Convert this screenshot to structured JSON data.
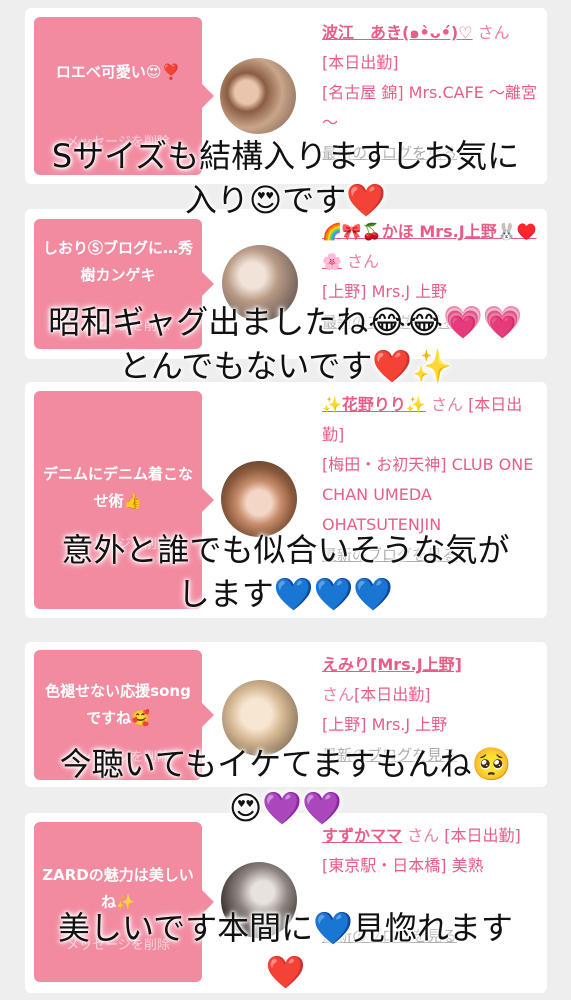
{
  "delete_label": "メッセージを削除",
  "blog_label": "最新のブログを見る",
  "san_suffix": "さん",
  "cards": [
    {
      "message": "ロエベ可愛い😍❣️",
      "name": "波江　あき(๑•̀ᴗ•́)♡",
      "status": "[本日出勤]",
      "shop": "[名古屋 錦] Mrs.CAFE ～離宮～"
    },
    {
      "message": "しおりⓈブログに…秀樹カンゲキ",
      "name": "🌈🎀🍒かほ Mrs.J上野🐰♥️🌸",
      "status": "",
      "shop": "[上野] Mrs.J 上野"
    },
    {
      "message": "デニムにデニム着こなせ術👍",
      "name": "✨花野りり✨",
      "status": "[本日出勤]",
      "shop": "[梅田・お初天神] CLUB ONE CHAN UMEDA OHATSUTENJIN"
    },
    {
      "message": "色褪せない応援songですね🥰",
      "name": "えみり[Mrs.J上野]",
      "status": "[本日出勤]",
      "shop": "[上野] Mrs.J 上野"
    },
    {
      "message": "ZARDの魅力は美しいね✨",
      "name": "すずかママ",
      "status": "[本日出勤]",
      "shop": "[東京駅・日本橋] 美熟"
    }
  ],
  "overlays": [
    [
      "Sサイズも結構入りますしお気に",
      "入り😍です❤️"
    ],
    [
      "昭和ギャグ出ましたね😂😂💗💗",
      "とんでもないです❤️✨"
    ],
    [
      "意外と誰でも似合いそうな気が",
      "します💙💙💙"
    ],
    [
      "今聴いてもイケてますもんね🥺",
      "😍💜💜"
    ],
    [
      "美しいです本間に💙見惚れます",
      "❤️"
    ]
  ],
  "colors": {
    "bubble": "#f28aa0",
    "name": "#e85d85",
    "blog": "#aaaaaa"
  }
}
